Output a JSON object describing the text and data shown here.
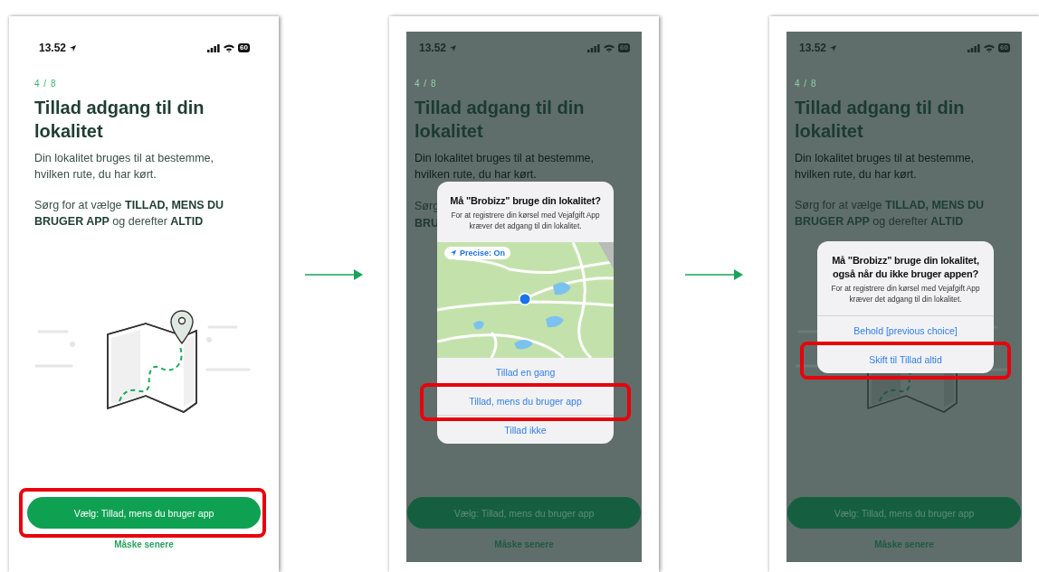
{
  "screens": [
    {
      "dimmed": false,
      "status": {
        "time": "13.52",
        "battery": "60"
      },
      "step": "4 / 8",
      "title": "Tillad adgang til din lokalitet",
      "description": "Din lokalitet bruges til at bestemme, hvilken rute, du har kørt.",
      "instruction": "Sørg for at vælge **TILLAD, MENS DU BRUGER APP** og derefter **ALTID**",
      "primary_button": {
        "label": "Vælg: Tillad, mens du bruger app",
        "highlighted": true
      },
      "secondary_link": "Måske senere"
    },
    {
      "dimmed": true,
      "status": {
        "time": "13.52",
        "battery": "60"
      },
      "step": "4 / 8",
      "title": "Tillad adgang til din lokalitet",
      "description": "Din lokalitet bruges til at bestemme, hvilken rute, du har kørt.",
      "instruction_fragments": [
        "Sørg",
        "**BRU**"
      ],
      "primary_button": {
        "label": "Vælg: Tillad, mens du bruger app",
        "highlighted": false
      },
      "secondary_link": "Måske senere",
      "dialog": {
        "kind": "map",
        "title": "Må \"Brobizz\" bruge din lokalitet?",
        "message": "For at registrere din kørsel med Vejafgift App kræver det adgang til din lokalitet.",
        "precise_label": "Precise: On",
        "options": [
          {
            "label": "Tillad en gang",
            "highlighted": false
          },
          {
            "label": "Tillad, mens du bruger app",
            "highlighted": true
          },
          {
            "label": "Tillad ikke",
            "highlighted": false
          }
        ]
      }
    },
    {
      "dimmed": true,
      "status": {
        "time": "13.52",
        "battery": "60"
      },
      "step": "4 / 8",
      "title": "Tillad adgang til din lokalitet",
      "description": "Din lokalitet bruges til at bestemme, hvilken rute, du har kørt.",
      "instruction": "Sørg for at vælge **TILLAD, MENS DU BRUGER APP** og derefter **ALTID**",
      "primary_button": {
        "label": "Vælg: Tillad, mens du bruger app",
        "highlighted": false
      },
      "secondary_link": "Måske senere",
      "dialog": {
        "kind": "plain",
        "title": "Må \"Brobizz\" bruge din lokalitet, også når du ikke bruger appen?",
        "message": "For at registrere din kørsel med Vejafgift App kræver det adgang til din lokalitet.",
        "options": [
          {
            "label": "Behold [previous choice]",
            "highlighted": false
          },
          {
            "label": "Skift til Tillad altid",
            "highlighted": true
          }
        ]
      }
    }
  ]
}
